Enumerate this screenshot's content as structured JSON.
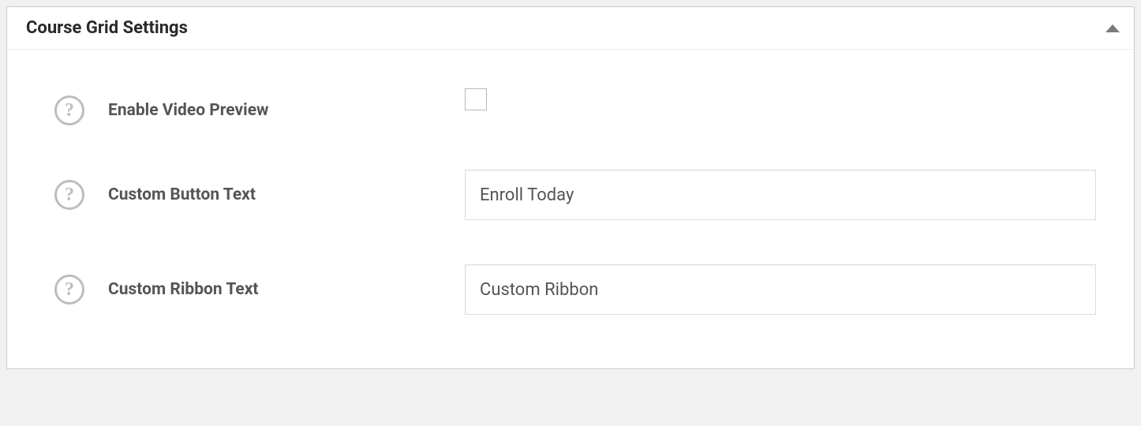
{
  "panel": {
    "title": "Course Grid Settings"
  },
  "fields": {
    "enable_video_preview": {
      "label": "Enable Video Preview",
      "checked": false
    },
    "custom_button_text": {
      "label": "Custom Button Text",
      "value": "Enroll Today"
    },
    "custom_ribbon_text": {
      "label": "Custom Ribbon Text",
      "value": "Custom Ribbon"
    }
  },
  "icons": {
    "help_glyph": "?"
  }
}
